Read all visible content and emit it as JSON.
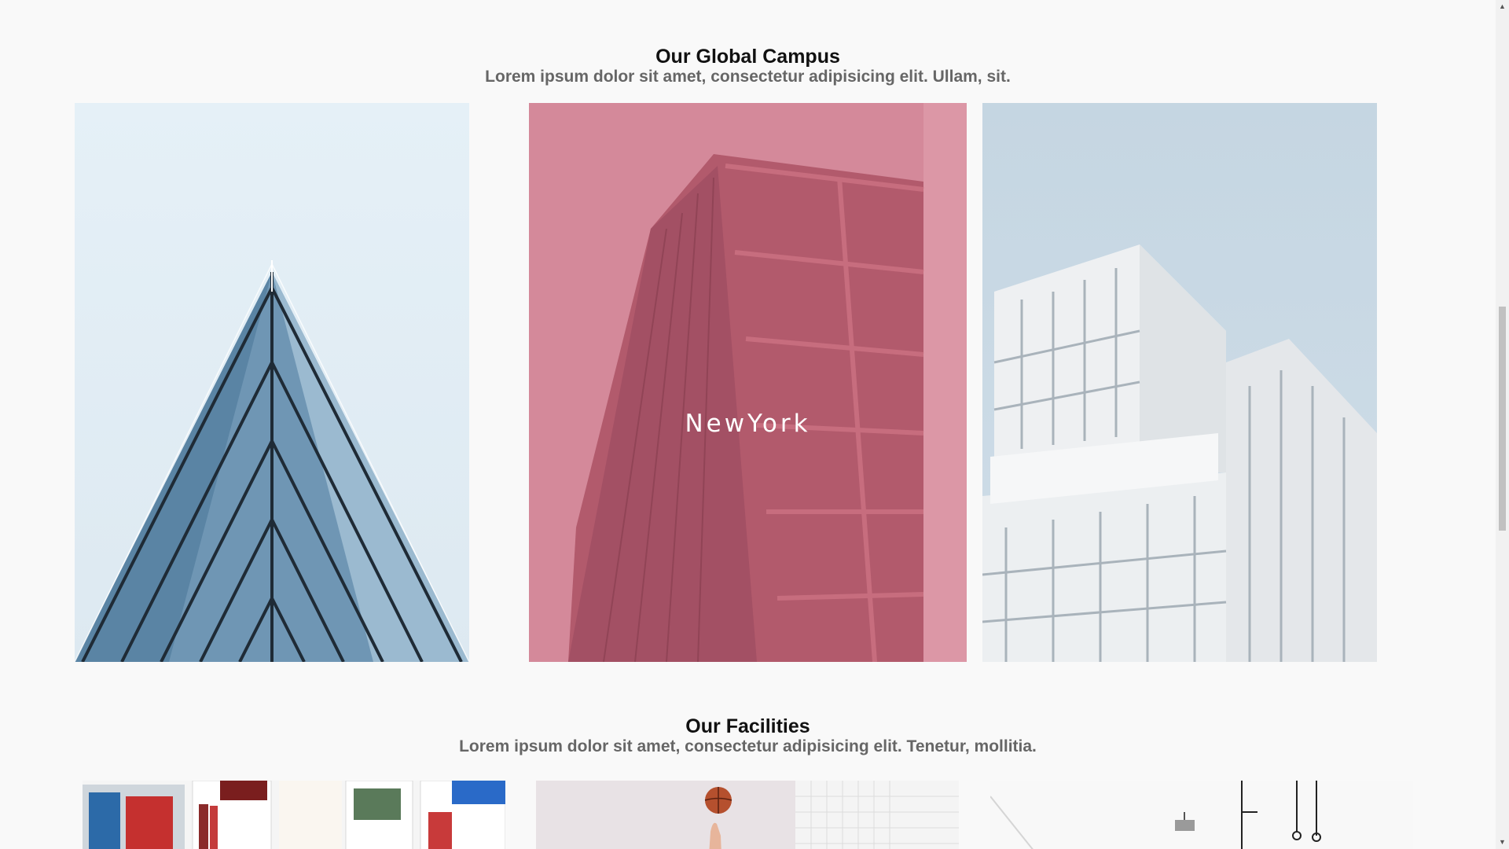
{
  "campus": {
    "title": "Our Global Campus",
    "subtitle": "Lorem ipsum dolor sit amet, consectetur adipisicing elit. Ullam, sit.",
    "cards": [
      {
        "image": "glass-pyramid-building",
        "label": ""
      },
      {
        "image": "red-glass-tower",
        "label": "NewYork",
        "overlay_color": "#dc97a6"
      },
      {
        "image": "white-modern-building",
        "label": ""
      }
    ]
  },
  "facilities": {
    "title": "Our Facilities",
    "subtitle": "Lorem ipsum dolor sit amet, consectetur adipisicing elit. Tenetur, mollitia.",
    "cards": [
      {
        "image": "library-bookshelf"
      },
      {
        "image": "basketball-player"
      },
      {
        "image": "white-classroom"
      }
    ]
  },
  "scrollbar": {
    "up_icon": "chevron-up-icon",
    "down_icon": "chevron-down-icon"
  }
}
